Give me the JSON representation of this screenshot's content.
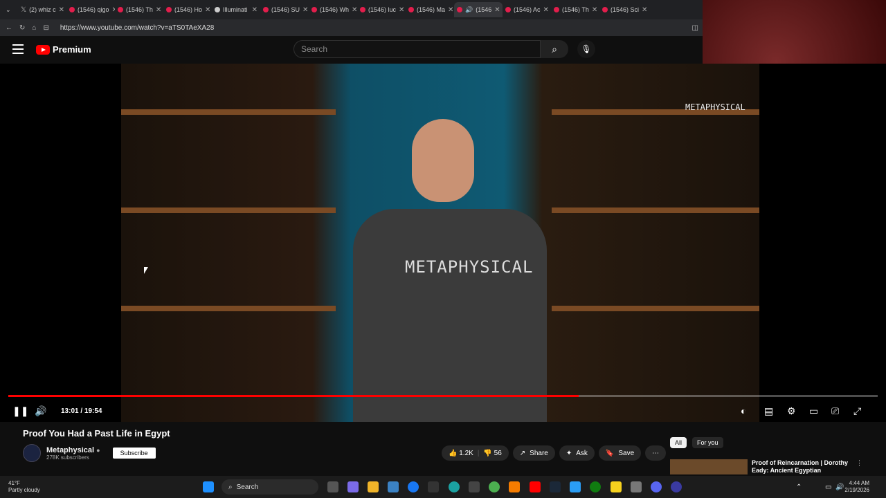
{
  "browser": {
    "tabs": [
      {
        "label": "(2) whiz c"
      },
      {
        "label": "(1546) qigo"
      },
      {
        "label": "(1546) Th"
      },
      {
        "label": "(1546) Ho"
      },
      {
        "label": "Illuminati"
      },
      {
        "label": "(1546) SU"
      },
      {
        "label": "(1546) Wh"
      },
      {
        "label": "(1546) luc"
      },
      {
        "label": "(1546) Ma"
      },
      {
        "label": "(1546"
      },
      {
        "label": "(1546) Ac"
      },
      {
        "label": "(1546) Th"
      },
      {
        "label": "(1546) Sci"
      }
    ],
    "url": "https://www.youtube.com/watch?v=aTS0TAeXA28"
  },
  "header": {
    "logo_text": "Premium",
    "search_placeholder": "Search"
  },
  "video": {
    "shirt_text": "METAPHYSICAL",
    "corner_watermark": "METAPHYSICAL",
    "timecode": "13:01 / 19:54",
    "progress": 0.656
  },
  "meta": {
    "title": "Proof You Had a Past Life in Egypt",
    "channel_name": "Metaphysical",
    "subscribers": "278K subscribers",
    "subscribe_label": "Subscribe",
    "like_count": "1.2K",
    "dislike_count": "56",
    "share_label": "Share",
    "ask_label": "Ask",
    "save_label": "Save"
  },
  "sidebar": {
    "chips": [
      "All",
      "For you"
    ],
    "rec_title": "Proof of Reincarnation | Dorothy Eady: Ancient Egyptian"
  },
  "taskbar": {
    "temp": "41°F",
    "weather": "Partly cloudy",
    "search_label": "Search",
    "time": "4:44 AM",
    "date": "2/19/2026"
  }
}
